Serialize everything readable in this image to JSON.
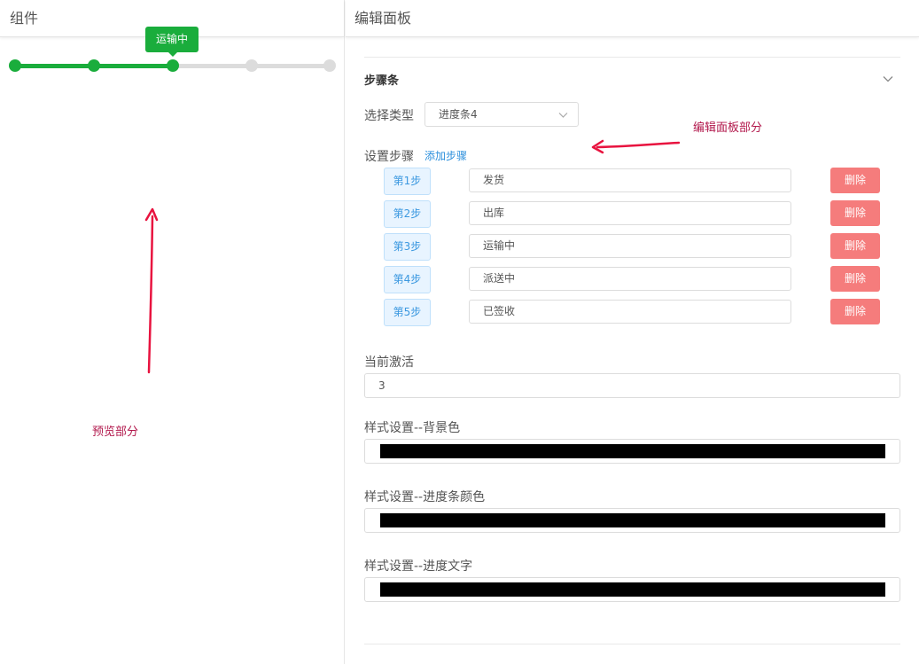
{
  "left": {
    "title": "组件",
    "progress": {
      "active_step": 3,
      "total_steps": 5,
      "tooltip": "运输中",
      "active_color": "#1aad3c",
      "inactive_color": "#dcdcdc"
    },
    "annotation": "预览部分"
  },
  "right": {
    "title": "编辑面板",
    "annotation": "编辑面板部分",
    "section_title": "步骤条",
    "type_label": "选择类型",
    "type_value": "进度条4",
    "steps_label": "设置步骤",
    "add_step_label": "添加步骤",
    "steps": [
      {
        "badge": "第1步",
        "value": "发货",
        "delete": "删除"
      },
      {
        "badge": "第2步",
        "value": "出库",
        "delete": "删除"
      },
      {
        "badge": "第3步",
        "value": "运输中",
        "delete": "删除"
      },
      {
        "badge": "第4步",
        "value": "派送中",
        "delete": "删除"
      },
      {
        "badge": "第5步",
        "value": "已签收",
        "delete": "删除"
      }
    ],
    "active_label": "当前激活",
    "active_value": "3",
    "bg_color_label": "样式设置--背景色",
    "bar_color_label": "样式设置--进度条颜色",
    "text_color_label": "样式设置--进度文字",
    "bg_color": "#000000",
    "bar_color": "#000000",
    "text_color": "#000000",
    "annotation_color": "#b2184c"
  }
}
